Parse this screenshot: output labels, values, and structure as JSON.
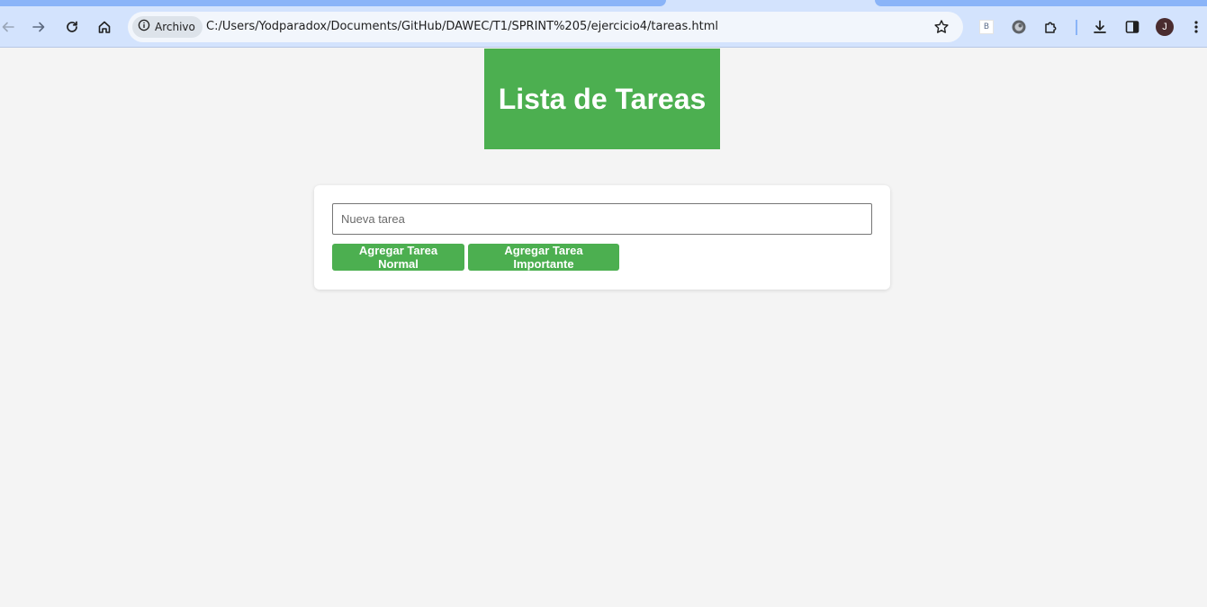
{
  "browser": {
    "security_chip": "Archivo",
    "url": "C:/Users/Yodparadox/Documents/GitHub/DAWEC/T1/SPRINT%205/ejercicio4/tareas.html",
    "extension_label": "B",
    "profile_initial": "J",
    "icons": [
      "back-icon",
      "forward-icon",
      "reload-icon",
      "home-icon",
      "info-icon",
      "bookmark-star-icon",
      "extension-icon",
      "puzzle-icon",
      "download-icon",
      "side-panel-icon",
      "menu-icon"
    ]
  },
  "page": {
    "title": "Lista de Tareas",
    "input_placeholder": "Nueva tarea",
    "add_normal_label": "Agregar Tarea Normal",
    "add_important_label": "Agregar Tarea Importante"
  },
  "colors": {
    "accent": "#4caf50",
    "background": "#f4f4f4",
    "chrome": "#d3e3fd"
  }
}
